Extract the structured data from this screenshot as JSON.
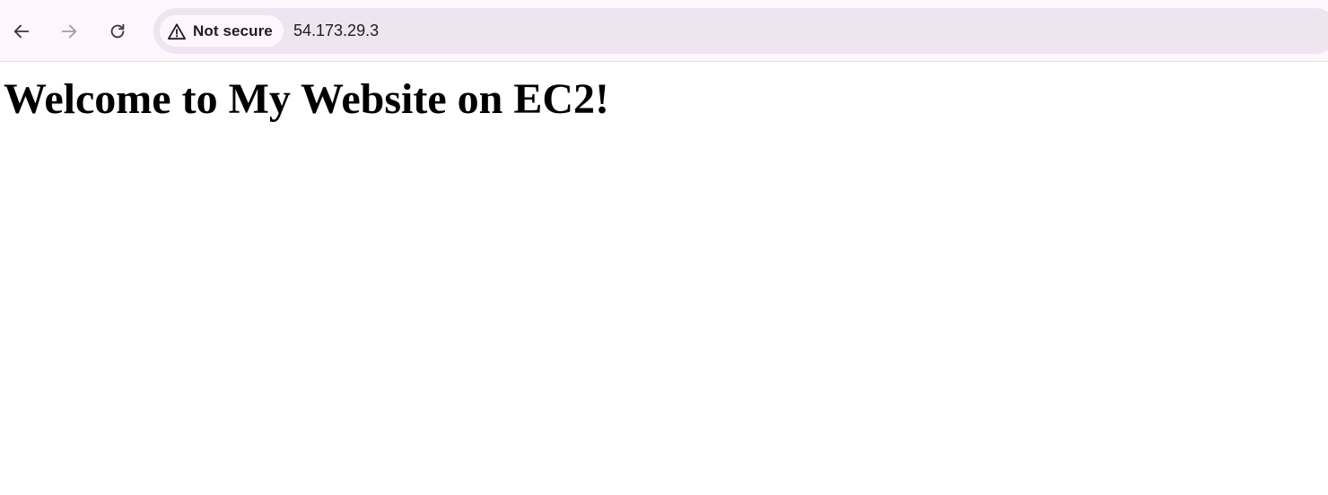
{
  "browser": {
    "nav": {
      "back_icon": "arrow-left-icon",
      "forward_icon": "arrow-right-icon",
      "reload_icon": "reload-icon"
    },
    "omnibox": {
      "security_icon": "warning-triangle-icon",
      "security_label": "Not secure",
      "url": "54.173.29.3"
    },
    "colors": {
      "toolbar_bg": "#fdf7fd",
      "omnibox_bg": "#efe5f0",
      "icon_active": "#3b363c",
      "icon_disabled": "#a29da3"
    }
  },
  "page": {
    "heading": "Welcome to My Website on EC2!"
  }
}
